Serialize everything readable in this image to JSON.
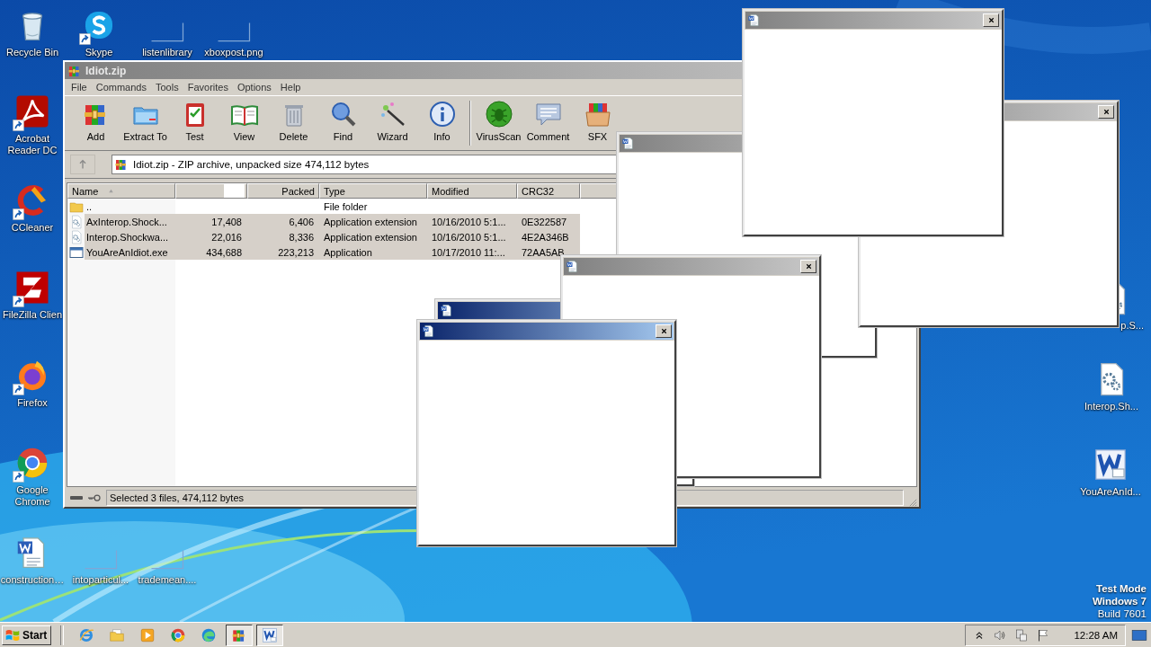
{
  "desktop_icons": [
    {
      "label": "Recycle Bin",
      "kind": "recycle",
      "shortcut": false
    },
    {
      "label": "Skype",
      "kind": "skype",
      "shortcut": true
    },
    {
      "label": "listenlibrary",
      "kind": "blank",
      "shortcut": false
    },
    {
      "label": "xboxpost.png",
      "kind": "blank",
      "shortcut": false
    },
    {
      "label": "Acrobat Reader DC",
      "kind": "acrobat",
      "shortcut": true
    },
    {
      "label": "CCleaner",
      "kind": "ccleaner",
      "shortcut": true
    },
    {
      "label": "FileZilla Clien",
      "kind": "filezilla",
      "shortcut": true
    },
    {
      "label": "Firefox",
      "kind": "firefox",
      "shortcut": true
    },
    {
      "label": "Google Chrome",
      "kind": "chrome",
      "shortcut": true
    },
    {
      "label": "construction…",
      "kind": "worddoc",
      "shortcut": false
    },
    {
      "label": "intoparticul...",
      "kind": "blank",
      "shortcut": false
    },
    {
      "label": "trademean....",
      "kind": "blank",
      "shortcut": false
    },
    {
      "label": "p.S...",
      "kind": "gearfile"
    },
    {
      "label": "Interop.Sh...",
      "kind": "gearfile",
      "shortcut": false
    },
    {
      "label": "YouAreAnId...",
      "kind": "word",
      "shortcut": false
    }
  ],
  "archiver_window": {
    "title": "Idiot.zip",
    "menu": [
      "File",
      "Commands",
      "Tools",
      "Favorites",
      "Options",
      "Help"
    ],
    "toolbar_groups": [
      [
        {
          "label": "Add",
          "kind": "add"
        },
        {
          "label": "Extract To",
          "kind": "extract"
        },
        {
          "label": "Test",
          "kind": "test"
        },
        {
          "label": "View",
          "kind": "view"
        },
        {
          "label": "Delete",
          "kind": "delete"
        },
        {
          "label": "Find",
          "kind": "find"
        },
        {
          "label": "Wizard",
          "kind": "wizard"
        },
        {
          "label": "Info",
          "kind": "info"
        }
      ],
      [
        {
          "label": "VirusScan",
          "kind": "virusscan"
        },
        {
          "label": "Comment",
          "kind": "comment"
        },
        {
          "label": "SFX",
          "kind": "sfx"
        }
      ]
    ],
    "address": "Idiot.zip - ZIP archive, unpacked size 474,112 bytes",
    "columns": [
      {
        "kind": "text",
        "label": "Name",
        "sorted_ascending": true
      },
      {
        "kind": "blank"
      },
      {
        "kind": "text",
        "label": "Packed"
      },
      {
        "kind": "text",
        "label": "Type"
      },
      {
        "kind": "text",
        "label": "Modified"
      },
      {
        "kind": "text",
        "label": "CRC32"
      }
    ],
    "rows": [
      {
        "kind": "folder",
        "name": "..",
        "type": "File folder",
        "selected": false
      },
      {
        "kind": "dll",
        "name": "AxInterop.Shock...",
        "size": "17,408",
        "packed": "6,406",
        "type": "Application extension",
        "modified": "10/16/2010 5:1...",
        "crc32": "0E322587",
        "selected": true
      },
      {
        "kind": "dll",
        "name": "Interop.Shockwa...",
        "size": "22,016",
        "packed": "8,336",
        "type": "Application extension",
        "modified": "10/16/2010 5:1...",
        "crc32": "4E2A346B",
        "selected": true
      },
      {
        "kind": "exe",
        "name": "YouAreAnIdiot.exe",
        "size": "434,688",
        "packed": "223,213",
        "type": "Application",
        "modified": "10/17/2010 11:...",
        "crc32": "72AA5AB",
        "selected": true
      }
    ],
    "status": "Selected 3 files, 474,112 bytes"
  },
  "popups": [
    {
      "active": false,
      "title_icon": true,
      "close_button": false
    },
    {
      "active": true,
      "title_icon": true,
      "close_button": false
    },
    {
      "active": false,
      "title_icon": false,
      "close_button": true
    },
    {
      "active": false,
      "title_icon": true,
      "close_button": true
    },
    {
      "active": false,
      "title_icon": true,
      "close_button": true
    },
    {
      "active": true,
      "title_icon": true,
      "close_button": true
    }
  ],
  "system_text": [
    {
      "text": "Test Mode",
      "bold": true
    },
    {
      "text": "Windows 7",
      "bold": true
    },
    {
      "text": "Build 7601",
      "bold": false
    }
  ],
  "taskbar": {
    "start": "Start",
    "items": [
      {
        "kind": "ie",
        "selected": false
      },
      {
        "kind": "explorer",
        "selected": false
      },
      {
        "kind": "mediaplayer",
        "selected": false
      },
      {
        "kind": "chrome",
        "selected": false
      },
      {
        "kind": "edge",
        "selected": false
      },
      {
        "kind": "winrar",
        "selected": true
      },
      {
        "kind": "word",
        "selected": true
      }
    ],
    "clock": "12:28 AM"
  }
}
